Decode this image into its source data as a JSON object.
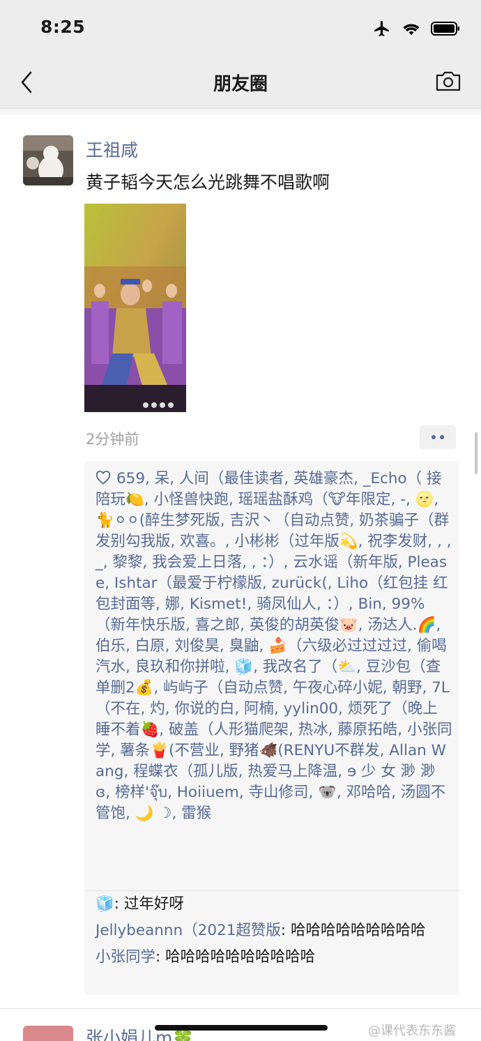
{
  "status_bar": {
    "time": "8:25",
    "icons": [
      "airplane-icon",
      "wifi-icon",
      "battery-icon"
    ]
  },
  "nav": {
    "title": "朋友圈",
    "back_icon": "chevron-left-icon",
    "camera_icon": "camera-icon"
  },
  "post": {
    "author": "王祖咸",
    "text": "黄子韬今天怎么光跳舞不唱歌啊",
    "time": "2分钟前",
    "more_icon": "more-dots-icon",
    "likes_icon": "heart-icon",
    "likes_text": "659, 呆, 人间（最佳读者, 英雄豪杰, _Echo（ 接陪玩🍋, 小怪兽快跑, 瑶瑶盐酥鸡（🐮年限定, -, 🌝, 🐈⚪⚪(醉生梦死版, 吉沢丶（自动点赞, 奶茶骗子（群发别勾我版, 欢喜。, 小彬彬（过年版💫, 祝李发财, , , _, 黎黎, 我会爱上日落, , ：）, 云水谣（新年版, Please, Ishtar（最爱于柠檬版, zurück(, Liho（红包挂 红包封面等, 娜, Kismet!, 骑凤仙人, ：）, Bin, 99%（新年快乐版, 喜之郎, 英俊的胡英俊🐷, 汤达人.🌈, 伯乐, 白原, 刘俊昊, 臭鼬, 🍰（六级必过过过过, 偷喝汽水, 良玖和你拼啦, 🧊, 我改名了（⛅, 豆沙包（查单删2💰, 屿屿子（自动点赞, 午夜心碎小妮, 朝野, 7L（不在, 灼, 你说的白, 阿楠, yylin00, 烦死了（晚上睡不着🍓, 破盖（人形猫爬架, 热冰, 藤原拓皓, 小张同学, 薯条🍟(不营业, 野猪🐗(RENYU不群发, Allan Wang, 程蝶衣（孤儿版, 热爱马上降温, ɘ 少 女 渺 渺 ɞ, 榜样'จุ๊บ, Hoiiuem, 寺山修司, 🐨, 邓哈哈, 汤圆不管饱, 🌙 ☽, 雷猴",
    "comments": [
      {
        "name": "🧊",
        "text": ": 过年好呀"
      },
      {
        "name": "Jellybeannn（2021超赞版",
        "text": ": 哈哈哈哈哈哈哈哈哈"
      },
      {
        "name": "小张同学",
        "text": ": 哈哈哈哈哈哈哈哈哈哈"
      }
    ]
  },
  "next_post": {
    "author": "张小娟儿m🍀"
  },
  "watermark": "@课代表东东酱"
}
